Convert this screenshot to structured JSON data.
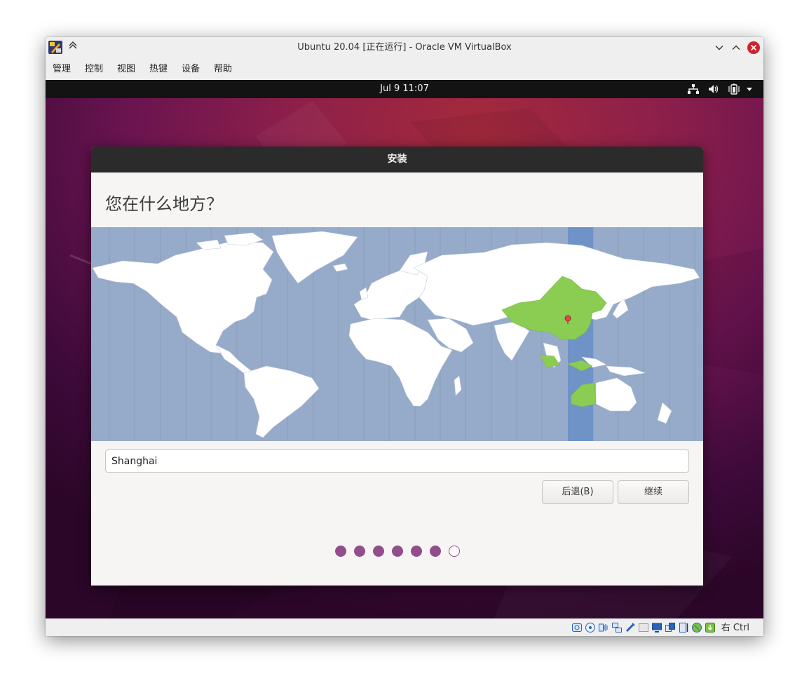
{
  "window": {
    "title": "Ubuntu 20.04 [正在运行] - Oracle VM VirtualBox"
  },
  "menubar": {
    "items": [
      {
        "label": "管理"
      },
      {
        "label": "控制"
      },
      {
        "label": "视图"
      },
      {
        "label": "热键"
      },
      {
        "label": "设备"
      },
      {
        "label": "帮助"
      }
    ]
  },
  "guest": {
    "clock": "Jul 9  11:07",
    "tray_icons": [
      "network-icon",
      "volume-icon",
      "battery-icon",
      "dropdown-arrow-icon"
    ]
  },
  "installer": {
    "title": "安装",
    "heading": "您在什么地方？",
    "location": {
      "value": "Shanghai",
      "placeholder": ""
    },
    "back_label": "后退(B)",
    "continue_label": "继续",
    "steps": {
      "total": 7,
      "current": 7
    },
    "map": {
      "ocean_color": "#96aac9",
      "land_color": "#ffffff",
      "selected_region_color": "#8acd52",
      "timezone_band_color": "#6f93c7",
      "marker_color": "#e0474c"
    }
  },
  "statusbar": {
    "icons": [
      "hard-disk-icon",
      "optical-drive-icon",
      "audio-icon",
      "network-adapter-icon",
      "usb-icon",
      "shared-folder-icon",
      "display-icon",
      "video-capture-icon",
      "recording-icon",
      "cpu-icon",
      "arrow-icon",
      "mouse-integration-icon"
    ],
    "host_key": "右 Ctrl"
  },
  "colors": {
    "accent": "#924d8b",
    "close_button": "#d0222b"
  }
}
